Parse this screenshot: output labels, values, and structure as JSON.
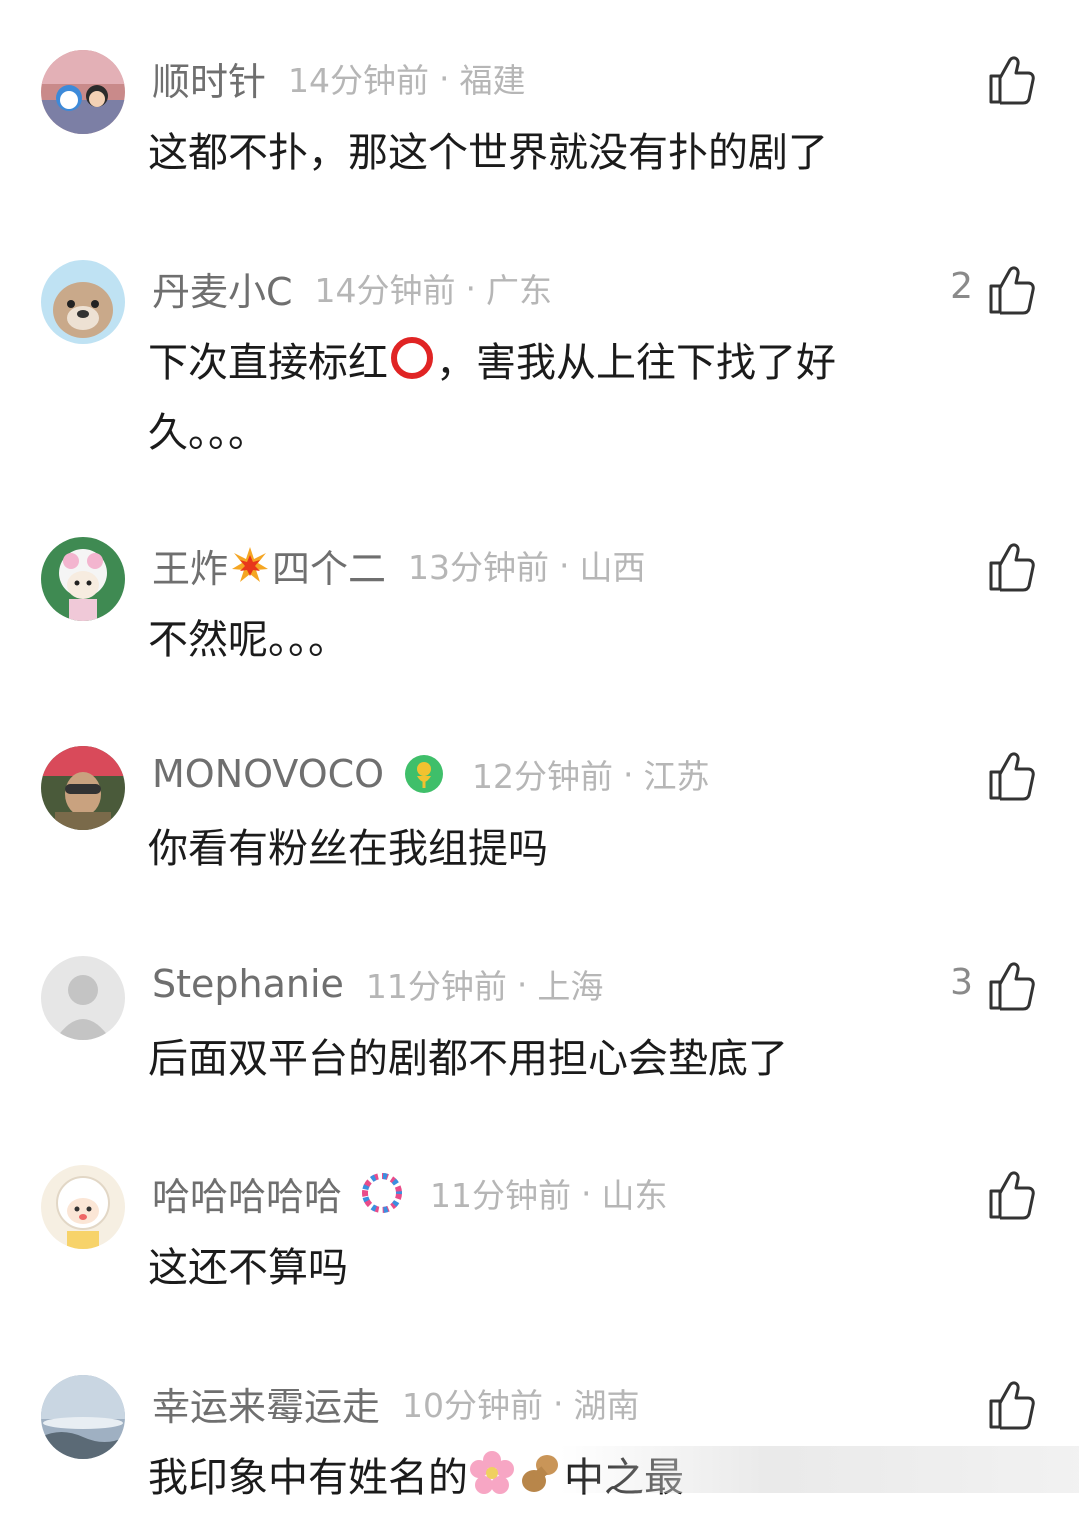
{
  "comments": [
    {
      "username": "顺时针",
      "time": "14分钟前",
      "region": "福建",
      "text": "这都不扑，那这个世界就没有扑的剧了",
      "likes": ""
    },
    {
      "username": "丹麦小C",
      "time": "14分钟前",
      "region": "广东",
      "text_before": "下次直接标红",
      "text_after": "，害我从上往下找了好久。。。",
      "likes": "2"
    },
    {
      "username_before": "王炸",
      "username_after": "四个二",
      "time": "13分钟前",
      "region": "山西",
      "text": "不然呢。。。",
      "likes": ""
    },
    {
      "username": "MONOVOCO",
      "time": "12分钟前",
      "region": "江苏",
      "text": "你看有粉丝在我组提吗",
      "likes": ""
    },
    {
      "username": "Stephanie",
      "time": "11分钟前",
      "region": "上海",
      "text": "后面双平台的剧都不用担心会垫底了",
      "likes": "3"
    },
    {
      "username": "哈哈哈哈哈",
      "time": "11分钟前",
      "region": "山东",
      "text": "这还不算吗",
      "likes": ""
    },
    {
      "username": "幸运来霉运走",
      "time": "10分钟前",
      "region": "湖南",
      "text_before": "我印象中有姓名的",
      "text_after": "中之最",
      "likes": ""
    }
  ],
  "separator": "·",
  "icons": {
    "like": "thumbs-up-icon",
    "red_circle": "heavy-large-circle-emoji",
    "explosion": "collision-emoji",
    "flower": "cherry-blossom-emoji",
    "peanut": "peanut-emoji"
  },
  "colors": {
    "username": "#6f6f6f",
    "meta": "#b6b6b6",
    "text": "#1b1b1b"
  }
}
